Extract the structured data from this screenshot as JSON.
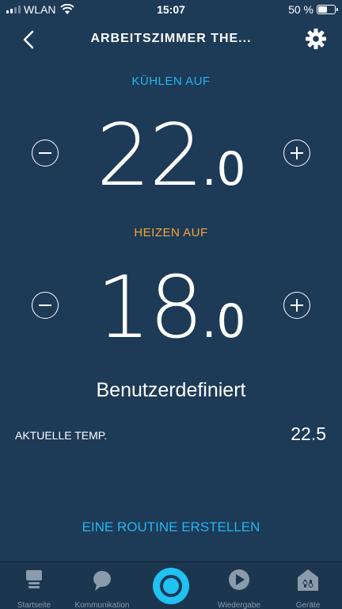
{
  "status": {
    "carrier": "WLAN",
    "time": "15:07",
    "battery": "50 %",
    "battery_level": 0.5
  },
  "header": {
    "title": "ARBEITSZIMMER THE..."
  },
  "cool": {
    "label": "KÜHLEN AUF",
    "value": "22",
    "decimal": ".0"
  },
  "heat": {
    "label": "HEIZEN AUF",
    "value": "18",
    "decimal": ".0"
  },
  "mode": "Benutzerdefiniert",
  "current": {
    "label": "AKTUELLE TEMP.",
    "value": "22.5"
  },
  "routine": "EINE ROUTINE ERSTELLEN",
  "nav": {
    "items": [
      {
        "label": "Startseite",
        "icon": "home-icon"
      },
      {
        "label": "Kommunikation",
        "icon": "chat-bubble-icon"
      },
      {
        "label": "",
        "icon": "alexa-icon"
      },
      {
        "label": "Wiedergabe",
        "icon": "play-icon"
      },
      {
        "label": "Geräte",
        "icon": "devices-icon"
      }
    ]
  },
  "colors": {
    "background": "#1d3a57",
    "cool_accent": "#22b6f2",
    "heat_accent": "#f6a63a",
    "alexa": "#1fc2f0"
  }
}
